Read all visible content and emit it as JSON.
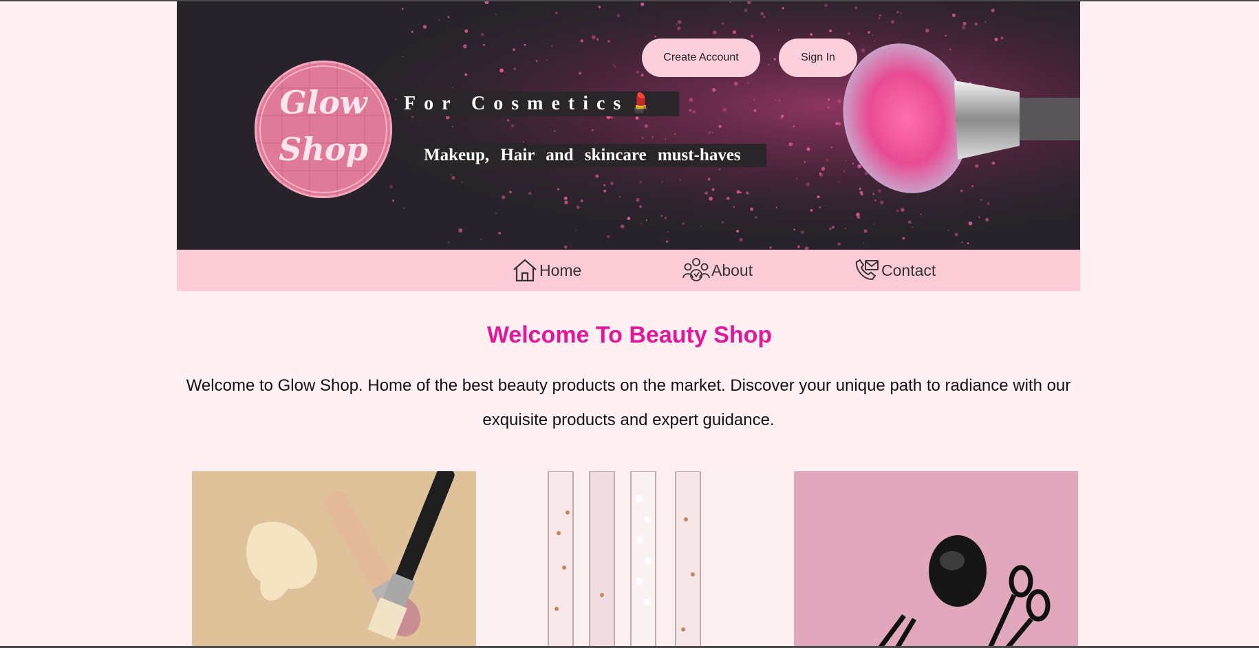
{
  "header": {
    "create_account_label": "Create Account",
    "sign_in_label": "Sign In",
    "logo_line1": "Glow",
    "logo_line2": "Shop",
    "tagline_title": "For Cosmetics",
    "tagline_emoji": "💄",
    "tagline_sub": "Makeup, Hair and skincare must-haves"
  },
  "nav": {
    "items": [
      {
        "label": "Home",
        "icon": "home-icon"
      },
      {
        "label": "About",
        "icon": "people-icon"
      },
      {
        "label": "Contact",
        "icon": "phone-icon"
      }
    ]
  },
  "main": {
    "title": "Welcome To Beauty Shop",
    "intro": "Welcome to Glow Shop. Home of the best beauty products on the market. Discover your unique path to radiance with our exquisite products and expert guidance."
  },
  "gallery": {
    "images": [
      {
        "subject": "makeup brushes with foundation",
        "accent": "#dfc19a"
      },
      {
        "subject": "glass tubes with serum",
        "accent": "#fdf0f3"
      },
      {
        "subject": "black stones and tools on pink",
        "accent": "#e1a7bd"
      }
    ]
  },
  "colors": {
    "page_bg": "#fff0f3",
    "hero_bg": "#28232a",
    "nav_bg": "#fbccd6",
    "button_bg": "#fbd0dc",
    "title_pink": "#e0189a"
  }
}
